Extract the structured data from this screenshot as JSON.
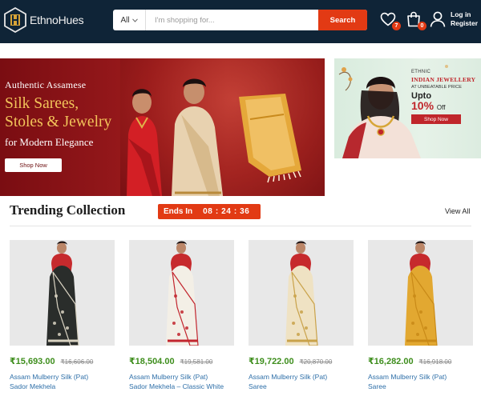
{
  "header": {
    "logo_text": "EthnoHues",
    "search": {
      "category": "All",
      "placeholder": "I'm shopping for...",
      "button_label": "Search"
    },
    "wishlist_count": "7",
    "cart_count": "0",
    "account": {
      "login_label": "Log in",
      "register_label": "Register"
    }
  },
  "banner_main": {
    "subtitle": "Authentic Assamese",
    "title_line1": "Silk Sarees,",
    "title_line2": "Stoles & Jewelry",
    "tagline": "for Modern Elegance",
    "button_label": "Shop Now"
  },
  "banner_side": {
    "eyebrow": "ETHNIC",
    "title": "INDIAN JEWELLERY",
    "subtitle": "AT UNBEATABLE PRICE",
    "upto": "Upto",
    "discount": "10%",
    "off_label": "Off",
    "button_label": "Shop Now"
  },
  "trending": {
    "title": "Trending Collection",
    "timer_label": "Ends In",
    "timer_value": "08 : 24 : 36",
    "view_all": "View All",
    "products": [
      {
        "price": "₹15,693.00",
        "mrp": "₹16,606.00",
        "name_line1": "Assam Mulberry Silk (Pat)",
        "name_line2": "Sador Mekhela",
        "saree_color": "#2a2d2b",
        "accent_color": "#d9d3c2"
      },
      {
        "price": "₹18,504.00",
        "mrp": "₹19,581.00",
        "name_line1": "Assam Mulberry Silk (Pat)",
        "name_line2": "Sador Mekhela – Classic White",
        "saree_color": "#f3efe6",
        "accent_color": "#c2262e"
      },
      {
        "price": "₹19,722.00",
        "mrp": "₹20,870.00",
        "name_line1": "Assam Mulberry Silk (Pat)",
        "name_line2": "Saree",
        "saree_color": "#efe2c3",
        "accent_color": "#c9a24a"
      },
      {
        "price": "₹16,282.00",
        "mrp": "₹16,918.00",
        "name_line1": "Assam Mulberry Silk (Pat)",
        "name_line2": "Saree",
        "saree_color": "#e2a831",
        "accent_color": "#c98a18"
      }
    ]
  }
}
